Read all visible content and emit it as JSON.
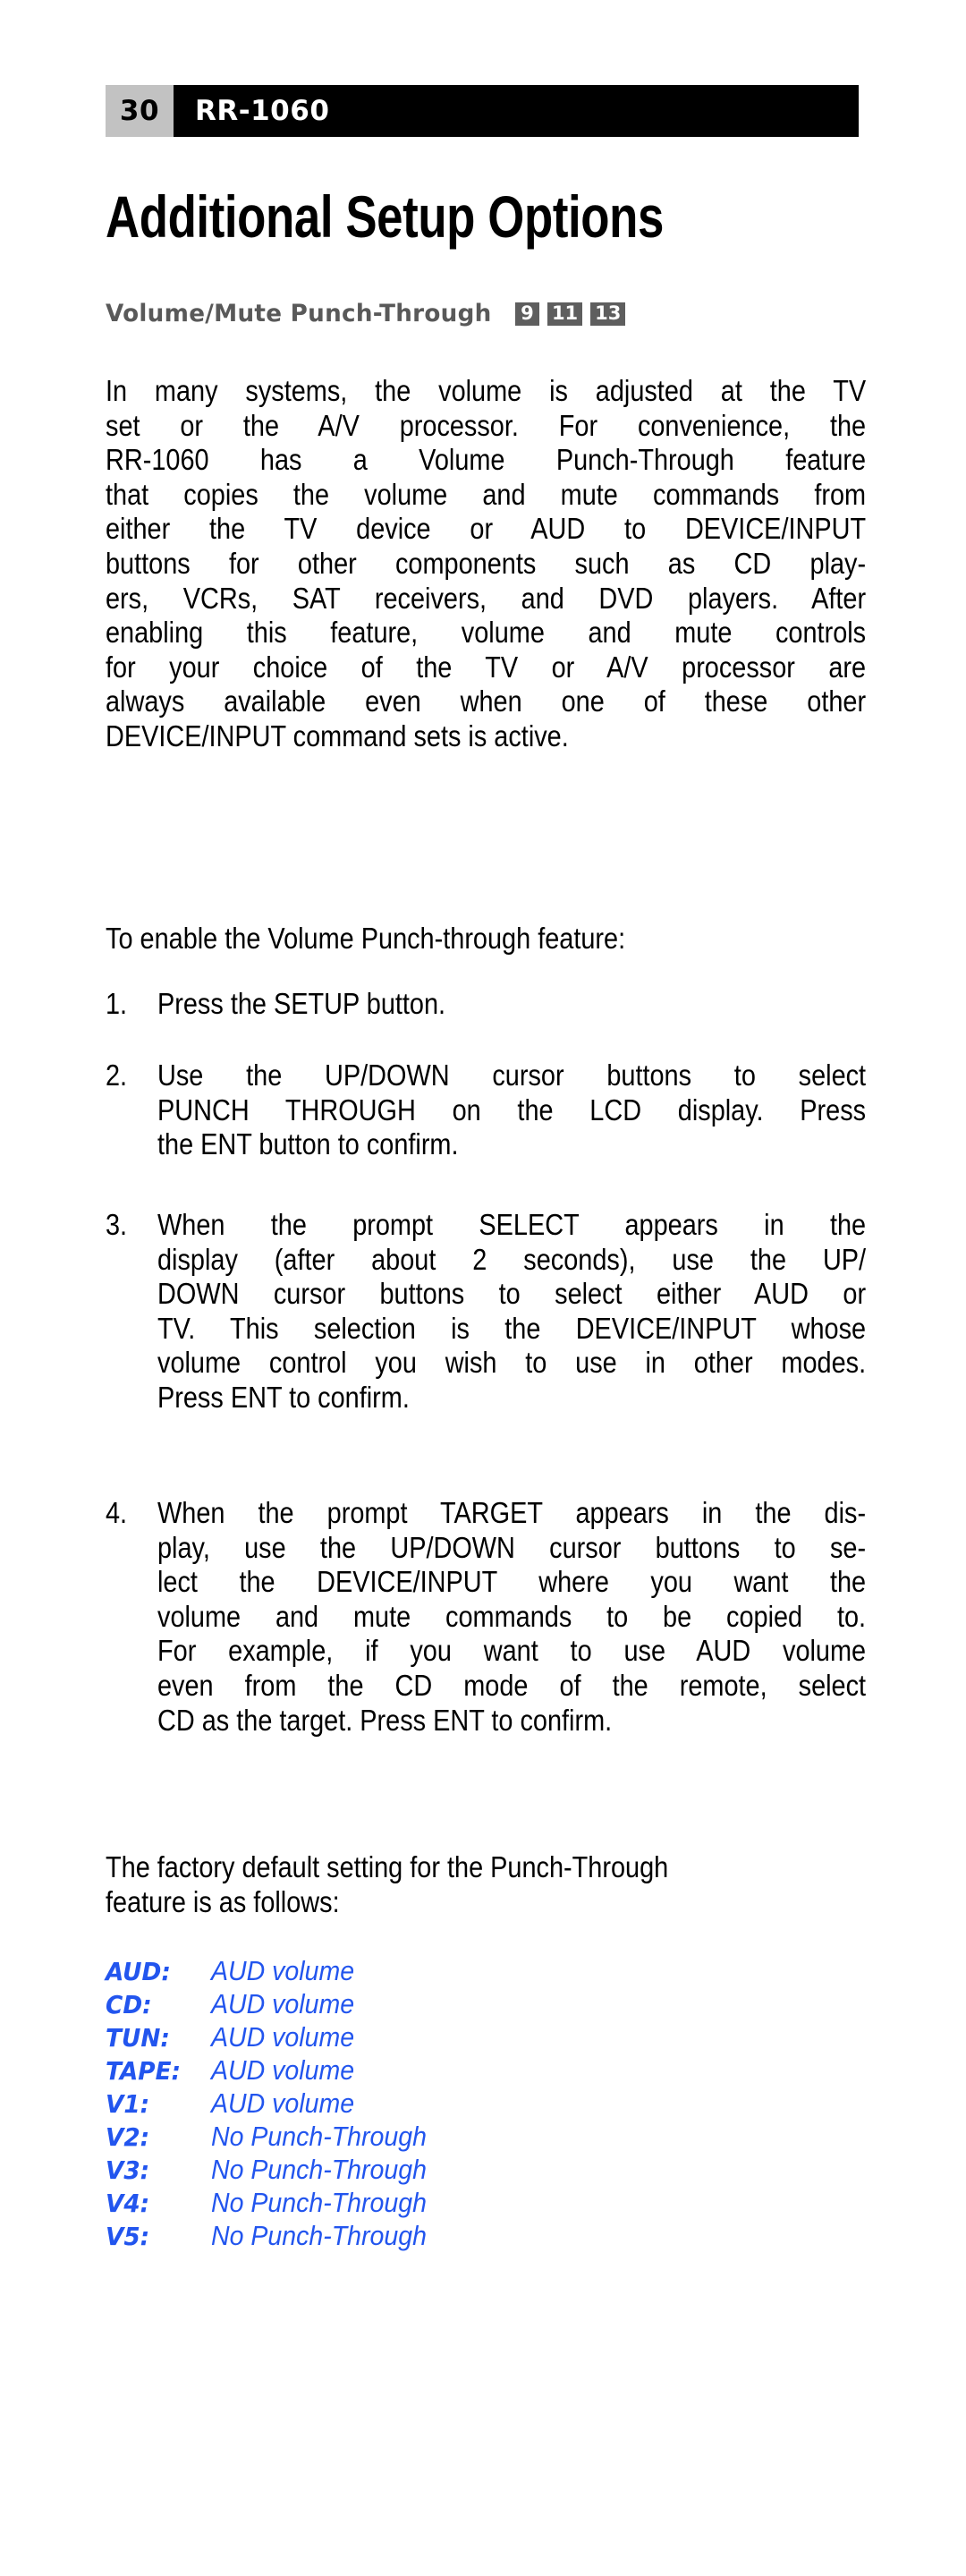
{
  "header": {
    "page_number": "30",
    "model": "RR-1060"
  },
  "title": "Additional Setup Options",
  "section": {
    "heading": "Volume/Mute Punch-Through",
    "badges": [
      "9",
      "11",
      "13"
    ]
  },
  "paragraphs": {
    "intro": [
      "In many systems, the volume is adjusted at the TV",
      "set or the A/V processor. For convenience, the",
      "RR-1060 has a Volume Punch-Through feature",
      "that copies the volume and  mute commands from",
      "either the TV device or AUD to DEVICE/INPUT",
      "buttons for other components such as CD play-",
      "ers, VCRs, SAT receivers, and DVD players. After",
      "enabling this feature, volume and mute controls",
      "for your choice of the TV or A/V processor are",
      "always available even when one of these other",
      "DEVICE/INPUT command sets is active."
    ],
    "enable_intro": [
      "To enable the Volume Punch-through feature:"
    ],
    "factory_default": [
      "The factory default setting for the Punch-Through",
      "feature is as follows:"
    ]
  },
  "steps": [
    {
      "number": "1.",
      "lines": [
        "Press the SETUP button."
      ]
    },
    {
      "number": "2.",
      "lines": [
        "Use the UP/DOWN cursor buttons to select",
        "PUNCH THROUGH on the LCD display. Press",
        "the ENT button to confirm."
      ]
    },
    {
      "number": "3.",
      "lines": [
        "When the prompt SELECT appears in the",
        "display (after about 2 seconds), use the UP/",
        "DOWN cursor buttons to select either AUD or",
        "TV. This selection is the DEVICE/INPUT whose",
        "volume control you wish to use in other modes.",
        "Press ENT to confirm."
      ]
    },
    {
      "number": "4.",
      "lines": [
        "When the prompt TARGET appears in the dis-",
        "play, use the UP/DOWN cursor buttons to se-",
        "lect the DEVICE/INPUT where you want the",
        "volume and mute commands to be copied to.",
        "For example, if you want to use AUD volume",
        "even from the CD mode of the remote, select",
        "CD as the target. Press ENT to confirm."
      ]
    }
  ],
  "defaults": {
    "rows": [
      {
        "label": "AUD:",
        "value": "AUD volume"
      },
      {
        "label": "CD:",
        "value": "AUD volume"
      },
      {
        "label": "TUN:",
        "value": "AUD volume"
      },
      {
        "label": "TAPE:",
        "value": "AUD volume"
      },
      {
        "label": "V1:",
        "value": "AUD volume"
      },
      {
        "label": "V2:",
        "value": "No Punch-Through"
      },
      {
        "label": "V3:",
        "value": "No Punch-Through"
      },
      {
        "label": "V4:",
        "value": "No Punch-Through"
      },
      {
        "label": "V5:",
        "value": "No Punch-Through"
      }
    ]
  },
  "colors": {
    "accent_blue": "#2255ee",
    "heading_gray": "#595959",
    "badge_gray": "#5e5e5e",
    "page_number_bg": "#c2c2c2",
    "header_bg": "#000000"
  }
}
